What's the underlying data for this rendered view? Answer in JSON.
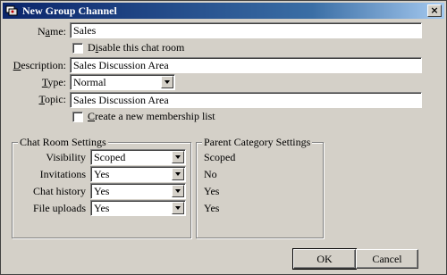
{
  "window": {
    "title": "New Group Channel"
  },
  "form": {
    "name_label_pre": "N",
    "name_label_u": "a",
    "name_label_post": "me:",
    "name_value": "Sales",
    "disable_label_pre": "D",
    "disable_label_u": "i",
    "disable_label_post": "sable this chat room",
    "description_label_pre": "",
    "description_label_u": "D",
    "description_label_post": "escription:",
    "description_value": "Sales Discussion Area",
    "type_label_pre": "",
    "type_label_u": "T",
    "type_label_post": "ype:",
    "type_value": "Normal",
    "topic_label_pre": "",
    "topic_label_u": "T",
    "topic_label_post": "opic:",
    "topic_value": "Sales Discussion Area",
    "membership_label_pre": "",
    "membership_label_u": "C",
    "membership_label_post": "reate a new membership list"
  },
  "chat_room_settings": {
    "title": "Chat Room Settings",
    "rows": [
      {
        "label": "Visibility",
        "value": "Scoped"
      },
      {
        "label": "Invitations",
        "value": "Yes"
      },
      {
        "label": "Chat history",
        "value": "Yes"
      },
      {
        "label": "File uploads",
        "value": "Yes"
      }
    ]
  },
  "parent_category_settings": {
    "title": "Parent Category Settings",
    "values": [
      "Scoped",
      "No",
      "Yes",
      "Yes"
    ]
  },
  "buttons": {
    "ok": "OK",
    "cancel": "Cancel"
  }
}
